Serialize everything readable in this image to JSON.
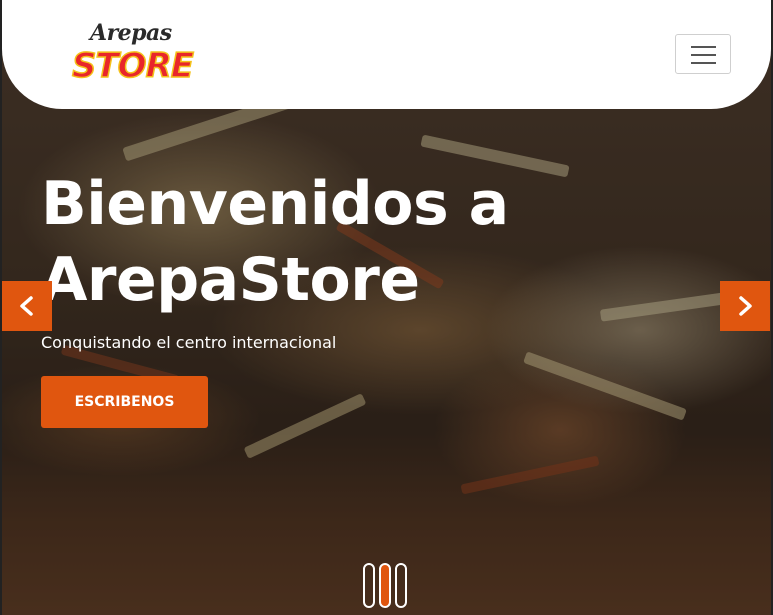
{
  "brand": {
    "logo_top": "Arepas",
    "logo_bottom": "STORE",
    "colors": {
      "red": "#e8262a",
      "yellow": "#f7cf1c"
    }
  },
  "header": {
    "menu_icon": "hamburger-menu-icon"
  },
  "hero": {
    "title": "Bienvenidos a ArepaStore",
    "subtitle": "Conquistando el centro internacional",
    "cta_label": "ESCRIBENOS",
    "accent_color": "#e0560f"
  },
  "carousel": {
    "prev_icon": "chevron-left-icon",
    "next_icon": "chevron-right-icon",
    "slides": 3,
    "active_index": 1
  }
}
